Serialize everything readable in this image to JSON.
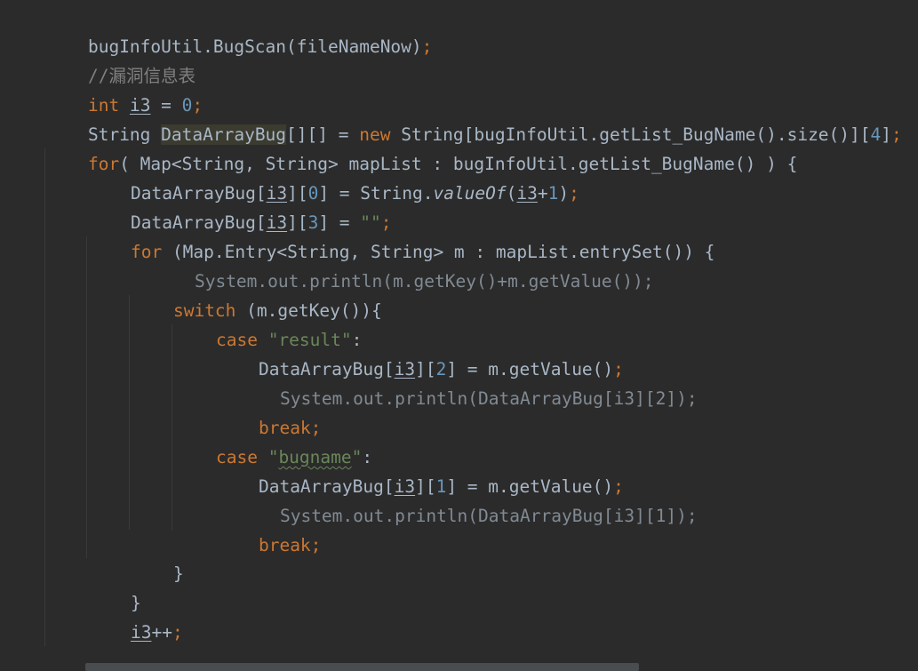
{
  "code": {
    "l1": {
      "a": "bugInfoUtil.BugScan(fileNameNow)",
      "b": ";"
    },
    "l2": {
      "comment": "//漏洞信息表"
    },
    "l3": {
      "kw": "int",
      "var": "i3",
      "eq": " = ",
      "num": "0",
      "semi": ";"
    },
    "l4": {
      "t": "String ",
      "var": "DataArrayBug",
      "mid": "[][] = ",
      "kw": "new",
      "rest": " String[bugInfoUtil.getList_BugName().size()][",
      "num": "4",
      "end": "]",
      "semi": ";"
    },
    "l5": {
      "kw": "for",
      "rest": "( Map<String, String> mapList : bugInfoUtil.getList_BugName() ) {"
    },
    "l6": {
      "a": "DataArrayBug[",
      "var": "i3",
      "b": "][",
      "num": "0",
      "c": "] = String.",
      "fn": "valueOf",
      "d": "(",
      "var2": "i3",
      "e": "+",
      "num2": "1",
      "f": ")",
      "semi": ";"
    },
    "l7": {
      "a": "DataArrayBug[",
      "var": "i3",
      "b": "][",
      "num": "3",
      "c": "] = ",
      "str": "\"\"",
      "semi": ";"
    },
    "l8": {
      "kw": "for",
      "rest": " (Map.Entry<String, String> m : mapList.entrySet()) {"
    },
    "l9": {
      "text": "System.out.println(m.getKey()+m.getValue());"
    },
    "l10": {
      "kw": "switch",
      "rest": " (m.getKey()){"
    },
    "l11": {
      "kw": "case",
      "sp": " ",
      "str": "\"result\"",
      "colon": ":"
    },
    "l12": {
      "a": "DataArrayBug[",
      "var": "i3",
      "b": "][",
      "num": "2",
      "c": "] = m.getValue()",
      "semi": ";"
    },
    "l13": {
      "text": "System.out.println(DataArrayBug[i3][2]);"
    },
    "l14": {
      "kw": "break",
      "semi": ";"
    },
    "l15": {
      "kw": "case",
      "sp": " ",
      "q1": "\"",
      "word": "bugname",
      "q2": "\"",
      "colon": ":"
    },
    "l16": {
      "a": "DataArrayBug[",
      "var": "i3",
      "b": "][",
      "num": "1",
      "c": "] = m.getValue()",
      "semi": ";"
    },
    "l17": {
      "text": "System.out.println(DataArrayBug[i3][1]);"
    },
    "l18": {
      "kw": "break",
      "semi": ";"
    },
    "l19": {
      "brace": "}"
    },
    "l20": {
      "brace": "}"
    },
    "l21": {
      "var": "i3",
      "op": "++",
      "semi": ";"
    },
    "l23": {
      "brace": "}"
    }
  },
  "colors": {
    "background": "#2b2b2b",
    "keyword": "#cc7832",
    "number": "#6897bb",
    "string": "#6a8759",
    "comment": "#808080",
    "default": "#a9b7c6"
  }
}
